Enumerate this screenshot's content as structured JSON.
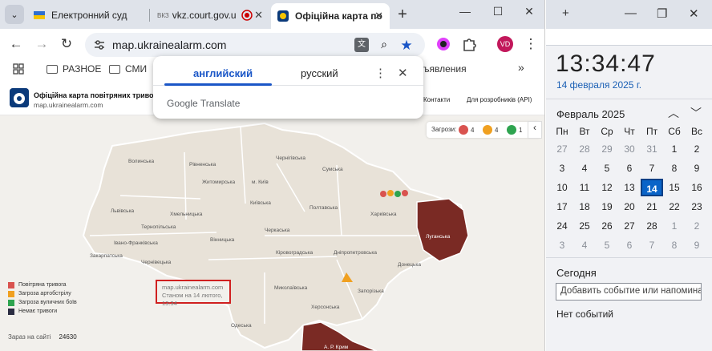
{
  "browser": {
    "tabs": [
      {
        "title": "Електронний суд"
      },
      {
        "title": "ВКЗ",
        "title2": "vkz.court.gov.u"
      },
      {
        "title": "Офіційна карта по"
      }
    ],
    "url": "map.ukrainealarm.com",
    "profile_initials": "VD",
    "bookmarks": [
      "РАЗНОЕ",
      "СМИ"
    ],
    "bookmark_more": "»",
    "bookmark_partial": "ъявления"
  },
  "site": {
    "title": "Офіційна карта повітряних тривог Укр",
    "subtitle": "map.ukrainealarm.com",
    "nav": [
      "Контакти",
      "Для розробників (API)"
    ]
  },
  "translate": {
    "lang_active": "английский",
    "lang_other": "русский",
    "brand": "Google Translate"
  },
  "map": {
    "threats_label": "Загрози:",
    "threat_counts": [
      "4",
      "4",
      "1"
    ],
    "regions": [
      {
        "name": "Волинська"
      },
      {
        "name": "Рівненська"
      },
      {
        "name": "Житомирська"
      },
      {
        "name": "м. Київ"
      },
      {
        "name": "Київська"
      },
      {
        "name": "Чернігівська"
      },
      {
        "name": "Сумська"
      },
      {
        "name": "Полтавська"
      },
      {
        "name": "Харківська"
      },
      {
        "name": "Львівська"
      },
      {
        "name": "Тернопільська"
      },
      {
        "name": "Хмельницька"
      },
      {
        "name": "Вінницька"
      },
      {
        "name": "Черкаська"
      },
      {
        "name": "Кіровоградська"
      },
      {
        "name": "Дніпропетровська"
      },
      {
        "name": "Донецька"
      },
      {
        "name": "Луганська"
      },
      {
        "name": "Івано-Франківська"
      },
      {
        "name": "Закарпатська"
      },
      {
        "name": "Чернівецька"
      },
      {
        "name": "Миколаївська"
      },
      {
        "name": "Запорізька"
      },
      {
        "name": "Херсонська"
      },
      {
        "name": "Одеська"
      },
      {
        "name": "А. Р. Крим"
      }
    ],
    "legend": [
      {
        "label": "Повітряна тривога",
        "color": "#d9534f"
      },
      {
        "label": "Загроза артобстрілу",
        "color": "#f0a020"
      },
      {
        "label": "Загроза вуличних боїв",
        "color": "#2ea44f"
      },
      {
        "label": "Немає тривоги",
        "color": "#2b2d42"
      }
    ],
    "online_label": "Зараз на сайті",
    "online_count": "24630",
    "stamp_url": "map.ukrainealarm.com",
    "stamp_time": "Станом на 14 лютого, 13:34",
    "alarm_color": "#7a2a24"
  },
  "calendar": {
    "time": "13:34:47",
    "date": "14 февраля 2025 г.",
    "month": "Февраль 2025",
    "weekdays": [
      "Пн",
      "Вт",
      "Ср",
      "Чт",
      "Пт",
      "Сб",
      "Вс"
    ],
    "weeks": [
      [
        "27",
        "28",
        "29",
        "30",
        "31",
        "1",
        "2"
      ],
      [
        "3",
        "4",
        "5",
        "6",
        "7",
        "8",
        "9"
      ],
      [
        "10",
        "11",
        "12",
        "13",
        "14",
        "15",
        "16"
      ],
      [
        "17",
        "18",
        "19",
        "20",
        "21",
        "22",
        "23"
      ],
      [
        "24",
        "25",
        "26",
        "27",
        "28",
        "1",
        "2"
      ],
      [
        "3",
        "4",
        "5",
        "6",
        "7",
        "8",
        "9"
      ]
    ],
    "today_label": "Сегодня",
    "add_event_placeholder": "Добавить событие или напомина",
    "no_events": "Нет событий"
  }
}
